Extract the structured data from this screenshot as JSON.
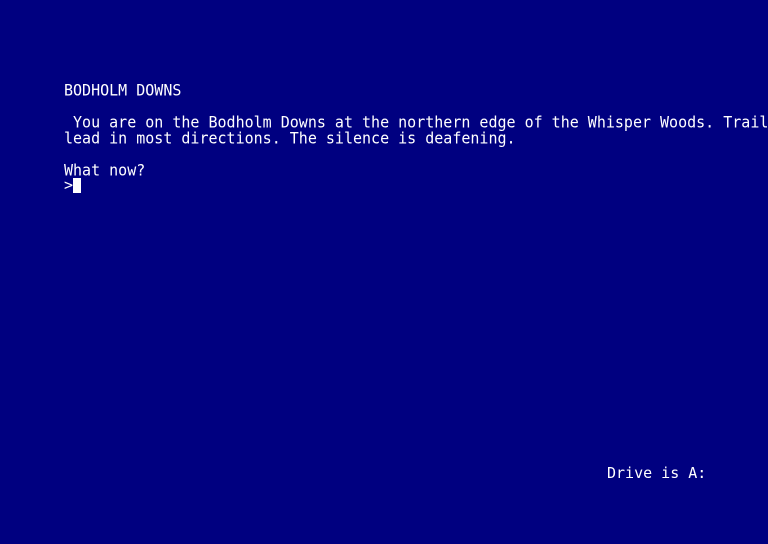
{
  "room": {
    "title": "BODHOLM DOWNS",
    "description_line1": " You are on the Bodholm Downs at the northern edge of the Whisper Woods. Trails",
    "description_line2": "lead in most directions. The silence is deafening."
  },
  "prompt": {
    "question": "What now?",
    "symbol": ">",
    "input_value": ""
  },
  "status": {
    "drive": "Drive is A:"
  },
  "colors": {
    "background": "#000080",
    "text": "#ffffff"
  }
}
